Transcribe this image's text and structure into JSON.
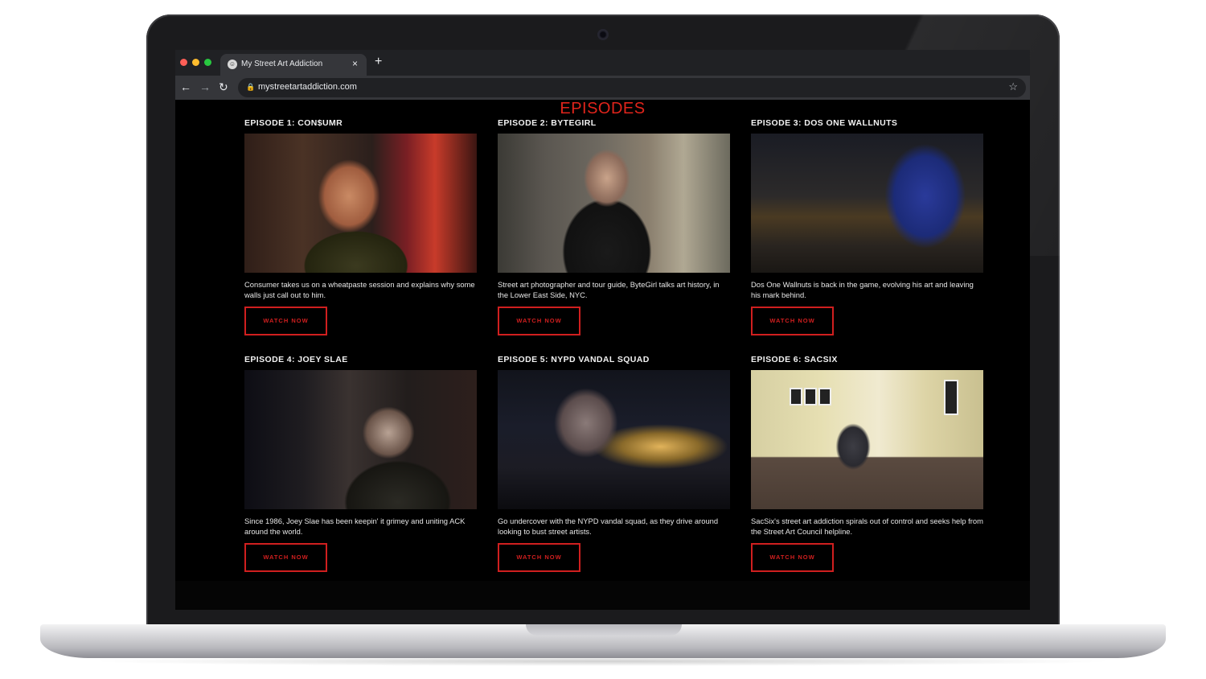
{
  "browser": {
    "tab_title": "My Street Art Addiction",
    "tab_close": "×",
    "new_tab": "+",
    "url": "mystreetartaddiction.com",
    "icons": {
      "back": "back-arrow-icon",
      "forward": "forward-arrow-icon",
      "reload": "reload-icon",
      "lock": "lock-icon",
      "bookmark": "star-icon"
    }
  },
  "page": {
    "heading": "EPISODES",
    "accent_color": "#d01f1f",
    "episodes": [
      {
        "title": "EPISODE 1: CON$UMR",
        "description": "Consumer takes us on a wheatpaste session and explains why some walls just call out to him.",
        "button": "WATCH NOW"
      },
      {
        "title": "EPISODE 2: BYTEGIRL",
        "description": "Street art photographer and tour guide, ByteGirl talks art history, in the Lower East Side, NYC.",
        "button": "WATCH NOW"
      },
      {
        "title": "EPISODE 3: DOS ONE WALLNUTS",
        "description": "Dos One Wallnuts is back in the game, evolving his art and leaving his mark behind.",
        "button": "WATCH NOW"
      },
      {
        "title": "EPISODE 4: JOEY SLAE",
        "description": "Since 1986, Joey Slae has been keepin' it grimey and uniting ACK around the world.",
        "button": "WATCH NOW"
      },
      {
        "title": "EPISODE 5: NYPD VANDAL SQUAD",
        "description": "Go undercover with the NYPD vandal squad, as they drive around looking to bust street artists.",
        "button": "WATCH NOW"
      },
      {
        "title": "EPISODE 6: SACSIX",
        "description": "SacSix's street art addiction spirals out of control and seeks help from the Street Art Council helpline.",
        "button": "WATCH NOW"
      }
    ]
  }
}
